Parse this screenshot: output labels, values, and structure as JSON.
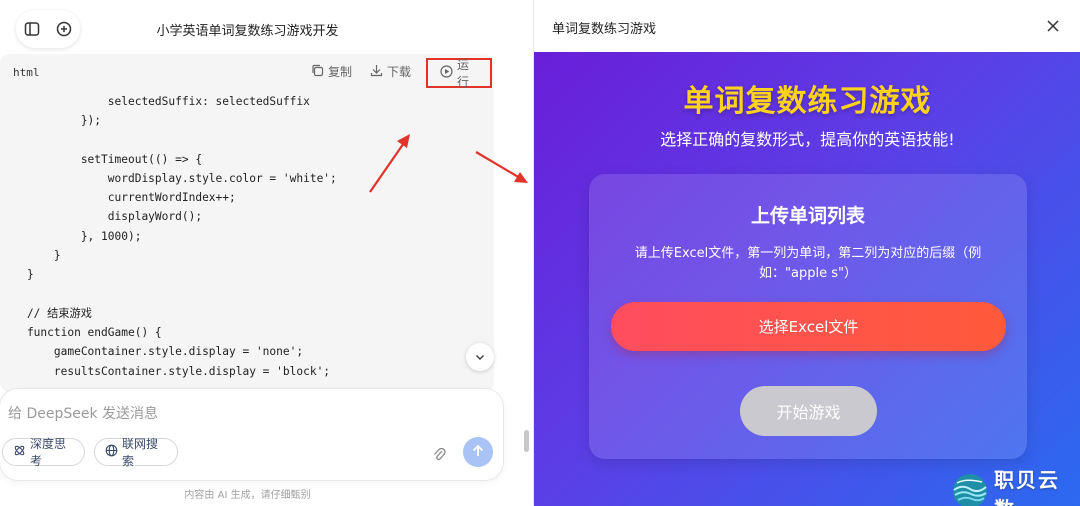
{
  "chat": {
    "title": "小学英语单词复数练习游戏开发"
  },
  "code_block": {
    "language": "html",
    "actions": {
      "copy": "复制",
      "download": "下载",
      "run": "运行"
    },
    "lines": [
      "                selectedSuffix: selectedSuffix",
      "            });",
      "",
      "            setTimeout(() => {",
      "                wordDisplay.style.color = 'white';",
      "                currentWordIndex++;",
      "                displayWord();",
      "            }, 1000);",
      "        }",
      "    }",
      "",
      "    // 结束游戏",
      "    function endGame() {",
      "        gameContainer.style.display = 'none';",
      "        resultsContainer.style.display = 'block';"
    ]
  },
  "input": {
    "placeholder": "给 DeepSeek 发送消息",
    "deep_think_label": "深度思考",
    "web_search_label": "联网搜索"
  },
  "disclaimer": "内容由 AI 生成，请仔细甄别",
  "preview": {
    "panel_title": "单词复数练习游戏",
    "game_title": "单词复数练习游戏",
    "game_subtitle": "选择正确的复数形式，提高你的英语技能!",
    "card_title": "上传单词列表",
    "card_description": "请上传Excel文件，第一列为单词，第二列为对应的后缀（例如：\"apple s\"）",
    "upload_button": "选择Excel文件",
    "start_button": "开始游戏"
  },
  "watermark": {
    "text": "职贝云数"
  },
  "colors": {
    "run_highlight": "#e0342b",
    "game_title": "#ffd21e",
    "upload_button": "#ff4d5e",
    "start_button_disabled": "#c9c9cf",
    "send_button": "#a9c3f6",
    "arrow": "#e0342b"
  }
}
